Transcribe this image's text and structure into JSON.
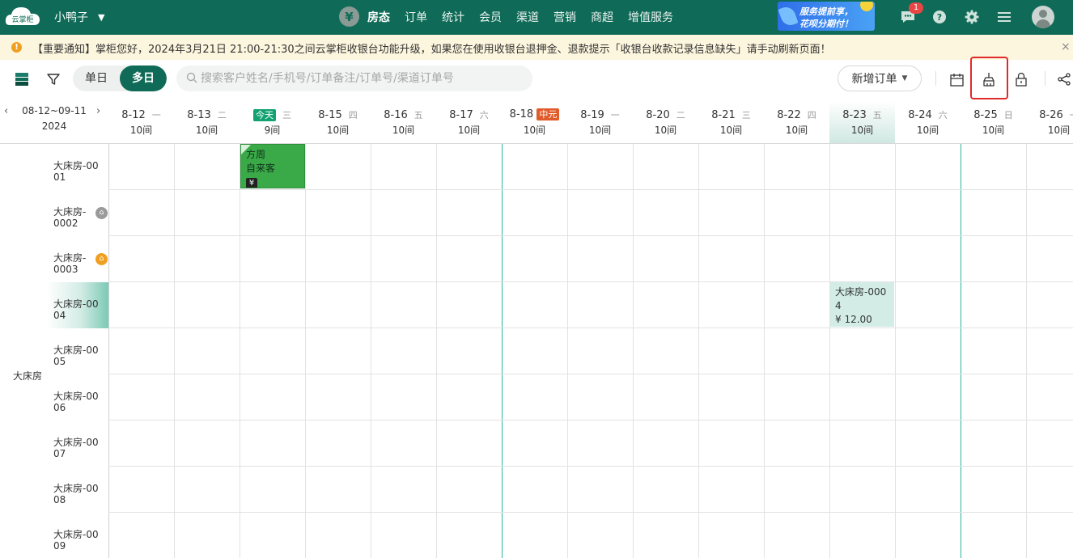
{
  "topbar": {
    "logo_text": "云掌柜",
    "shop_name": "小鸭子",
    "nav": [
      "房态",
      "订单",
      "统计",
      "会员",
      "渠道",
      "营销",
      "商超",
      "增值服务"
    ],
    "promo_line1": "服务提前享，",
    "promo_line2": "花呗分期付！",
    "message_badge": "1"
  },
  "notice": {
    "text": "【重要通知】掌柜您好，2024年3月21日 21:00-21:30之间云掌柜收银台功能升级，如果您在使用收银台退押金、退款提示「收银台收款记录信息缺失」请手动刷新页面！",
    "close": "×"
  },
  "toolbar": {
    "single_day": "单日",
    "multi_day": "多日",
    "search_placeholder": "搜索客户姓名/手机号/订单备注/订单号/渠道订单号",
    "new_order": "新增订单"
  },
  "calendar": {
    "range": "08-12~09-11",
    "year": "2024",
    "dates": [
      {
        "date": "8-12",
        "weekday": "一",
        "rooms": "10间"
      },
      {
        "date": "8-13",
        "weekday": "二",
        "rooms": "10间"
      },
      {
        "date": "",
        "tag": "今天",
        "weekday": "三",
        "rooms": "9间"
      },
      {
        "date": "8-15",
        "weekday": "四",
        "rooms": "10间"
      },
      {
        "date": "8-16",
        "weekday": "五",
        "rooms": "10间"
      },
      {
        "date": "8-17",
        "weekday": "六",
        "rooms": "10间"
      },
      {
        "date": "8-18",
        "tag": "中元",
        "weekday": "",
        "rooms": "10间"
      },
      {
        "date": "8-19",
        "weekday": "一",
        "rooms": "10间"
      },
      {
        "date": "8-20",
        "weekday": "二",
        "rooms": "10间"
      },
      {
        "date": "8-21",
        "weekday": "三",
        "rooms": "10间"
      },
      {
        "date": "8-22",
        "weekday": "四",
        "rooms": "10间"
      },
      {
        "date": "8-23",
        "weekday": "五",
        "rooms": "10间"
      },
      {
        "date": "8-24",
        "weekday": "六",
        "rooms": "10间"
      },
      {
        "date": "8-25",
        "weekday": "日",
        "rooms": "10间"
      },
      {
        "date": "8-26",
        "weekday": "一",
        "rooms": "10间"
      }
    ],
    "room_type": "大床房",
    "rooms": [
      {
        "line1": "大床房-00",
        "line2": "01"
      },
      {
        "line1": "大床房-",
        "line2": "0002"
      },
      {
        "line1": "大床房-",
        "line2": "0003"
      },
      {
        "line1": "大床房-00",
        "line2": "04"
      },
      {
        "line1": "大床房-00",
        "line2": "05"
      },
      {
        "line1": "大床房-00",
        "line2": "06"
      },
      {
        "line1": "大床房-00",
        "line2": "07"
      },
      {
        "line1": "大床房-00",
        "line2": "08"
      },
      {
        "line1": "大床房-00",
        "line2": "09"
      }
    ],
    "bookings": [
      {
        "name": "方周",
        "source": "自来客",
        "icon": "¥"
      },
      {
        "line1": "大床房-000",
        "line2": "4",
        "price": "¥ 12.00"
      }
    ]
  },
  "colors": {
    "brand": "#0f6b57",
    "accent_teal": "#2bb59a",
    "booking_green": "#3aaa48",
    "highlight_red": "#e02a2a"
  }
}
